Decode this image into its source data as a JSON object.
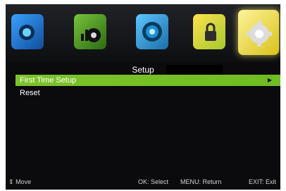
{
  "menu": {
    "title": "Setup",
    "icons": [
      "picture-icon",
      "sound-icon",
      "channel-icon",
      "lock-icon",
      "setup-gear-icon"
    ],
    "items": [
      {
        "label": "First Time Setup",
        "selected": true
      },
      {
        "label": "Reset",
        "selected": false
      }
    ]
  },
  "footer": {
    "move": "Move",
    "ok": "OK: Select",
    "menu": "MENU: Return",
    "exit": "EXIT: Exit"
  },
  "colors": {
    "accent": "#7cc32b",
    "background": "#0b0b0d"
  }
}
